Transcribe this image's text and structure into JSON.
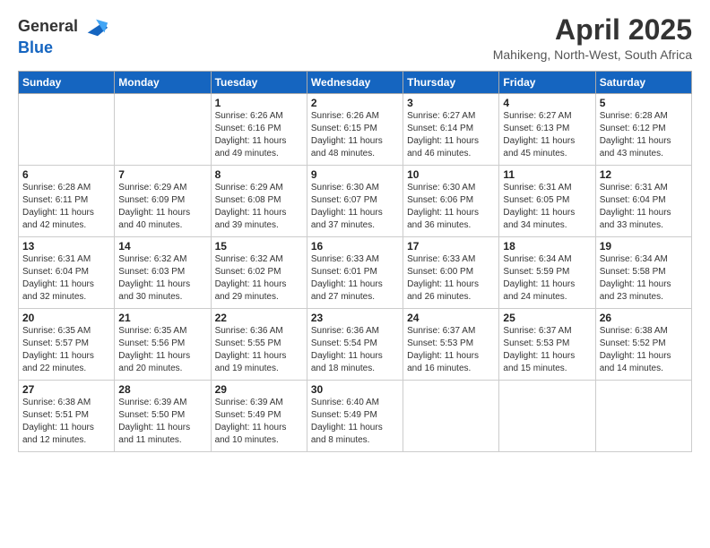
{
  "header": {
    "logo_line1": "General",
    "logo_line2": "Blue",
    "month_year": "April 2025",
    "location": "Mahikeng, North-West, South Africa"
  },
  "weekdays": [
    "Sunday",
    "Monday",
    "Tuesday",
    "Wednesday",
    "Thursday",
    "Friday",
    "Saturday"
  ],
  "weeks": [
    [
      {
        "day": "",
        "info": ""
      },
      {
        "day": "",
        "info": ""
      },
      {
        "day": "1",
        "info": "Sunrise: 6:26 AM\nSunset: 6:16 PM\nDaylight: 11 hours and 49 minutes."
      },
      {
        "day": "2",
        "info": "Sunrise: 6:26 AM\nSunset: 6:15 PM\nDaylight: 11 hours and 48 minutes."
      },
      {
        "day": "3",
        "info": "Sunrise: 6:27 AM\nSunset: 6:14 PM\nDaylight: 11 hours and 46 minutes."
      },
      {
        "day": "4",
        "info": "Sunrise: 6:27 AM\nSunset: 6:13 PM\nDaylight: 11 hours and 45 minutes."
      },
      {
        "day": "5",
        "info": "Sunrise: 6:28 AM\nSunset: 6:12 PM\nDaylight: 11 hours and 43 minutes."
      }
    ],
    [
      {
        "day": "6",
        "info": "Sunrise: 6:28 AM\nSunset: 6:11 PM\nDaylight: 11 hours and 42 minutes."
      },
      {
        "day": "7",
        "info": "Sunrise: 6:29 AM\nSunset: 6:09 PM\nDaylight: 11 hours and 40 minutes."
      },
      {
        "day": "8",
        "info": "Sunrise: 6:29 AM\nSunset: 6:08 PM\nDaylight: 11 hours and 39 minutes."
      },
      {
        "day": "9",
        "info": "Sunrise: 6:30 AM\nSunset: 6:07 PM\nDaylight: 11 hours and 37 minutes."
      },
      {
        "day": "10",
        "info": "Sunrise: 6:30 AM\nSunset: 6:06 PM\nDaylight: 11 hours and 36 minutes."
      },
      {
        "day": "11",
        "info": "Sunrise: 6:31 AM\nSunset: 6:05 PM\nDaylight: 11 hours and 34 minutes."
      },
      {
        "day": "12",
        "info": "Sunrise: 6:31 AM\nSunset: 6:04 PM\nDaylight: 11 hours and 33 minutes."
      }
    ],
    [
      {
        "day": "13",
        "info": "Sunrise: 6:31 AM\nSunset: 6:04 PM\nDaylight: 11 hours and 32 minutes."
      },
      {
        "day": "14",
        "info": "Sunrise: 6:32 AM\nSunset: 6:03 PM\nDaylight: 11 hours and 30 minutes."
      },
      {
        "day": "15",
        "info": "Sunrise: 6:32 AM\nSunset: 6:02 PM\nDaylight: 11 hours and 29 minutes."
      },
      {
        "day": "16",
        "info": "Sunrise: 6:33 AM\nSunset: 6:01 PM\nDaylight: 11 hours and 27 minutes."
      },
      {
        "day": "17",
        "info": "Sunrise: 6:33 AM\nSunset: 6:00 PM\nDaylight: 11 hours and 26 minutes."
      },
      {
        "day": "18",
        "info": "Sunrise: 6:34 AM\nSunset: 5:59 PM\nDaylight: 11 hours and 24 minutes."
      },
      {
        "day": "19",
        "info": "Sunrise: 6:34 AM\nSunset: 5:58 PM\nDaylight: 11 hours and 23 minutes."
      }
    ],
    [
      {
        "day": "20",
        "info": "Sunrise: 6:35 AM\nSunset: 5:57 PM\nDaylight: 11 hours and 22 minutes."
      },
      {
        "day": "21",
        "info": "Sunrise: 6:35 AM\nSunset: 5:56 PM\nDaylight: 11 hours and 20 minutes."
      },
      {
        "day": "22",
        "info": "Sunrise: 6:36 AM\nSunset: 5:55 PM\nDaylight: 11 hours and 19 minutes."
      },
      {
        "day": "23",
        "info": "Sunrise: 6:36 AM\nSunset: 5:54 PM\nDaylight: 11 hours and 18 minutes."
      },
      {
        "day": "24",
        "info": "Sunrise: 6:37 AM\nSunset: 5:53 PM\nDaylight: 11 hours and 16 minutes."
      },
      {
        "day": "25",
        "info": "Sunrise: 6:37 AM\nSunset: 5:53 PM\nDaylight: 11 hours and 15 minutes."
      },
      {
        "day": "26",
        "info": "Sunrise: 6:38 AM\nSunset: 5:52 PM\nDaylight: 11 hours and 14 minutes."
      }
    ],
    [
      {
        "day": "27",
        "info": "Sunrise: 6:38 AM\nSunset: 5:51 PM\nDaylight: 11 hours and 12 minutes."
      },
      {
        "day": "28",
        "info": "Sunrise: 6:39 AM\nSunset: 5:50 PM\nDaylight: 11 hours and 11 minutes."
      },
      {
        "day": "29",
        "info": "Sunrise: 6:39 AM\nSunset: 5:49 PM\nDaylight: 11 hours and 10 minutes."
      },
      {
        "day": "30",
        "info": "Sunrise: 6:40 AM\nSunset: 5:49 PM\nDaylight: 11 hours and 8 minutes."
      },
      {
        "day": "",
        "info": ""
      },
      {
        "day": "",
        "info": ""
      },
      {
        "day": "",
        "info": ""
      }
    ]
  ]
}
